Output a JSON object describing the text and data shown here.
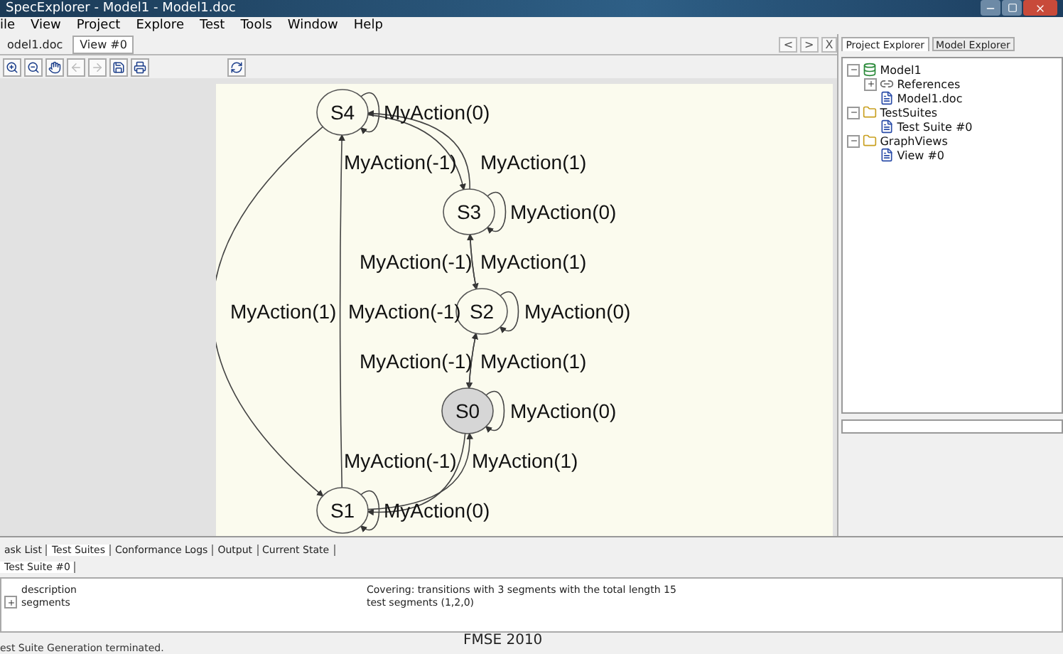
{
  "window": {
    "title": "SpecExplorer - Model1 - Model1.doc"
  },
  "menu": [
    "ile",
    "View",
    "Project",
    "Explore",
    "Test",
    "Tools",
    "Window",
    "Help"
  ],
  "document_tabs": [
    {
      "label": "odel1.doc",
      "selected": false
    },
    {
      "label": "View #0",
      "selected": true
    }
  ],
  "tab_controls": [
    "<",
    ">",
    "X"
  ],
  "toolbar": [
    {
      "kind": "zoom-in",
      "disabled": false
    },
    {
      "kind": "zoom-out",
      "disabled": false
    },
    {
      "kind": "hand",
      "disabled": false
    },
    {
      "kind": "back",
      "disabled": true
    },
    {
      "kind": "forward",
      "disabled": true
    },
    {
      "kind": "save",
      "disabled": false
    },
    {
      "kind": "print",
      "disabled": false
    },
    {
      "kind": "refresh",
      "disabled": false
    }
  ],
  "graph": {
    "nodes": [
      {
        "label": "S4",
        "initial": false
      },
      {
        "label": "S3",
        "initial": false
      },
      {
        "label": "S2",
        "initial": false
      },
      {
        "label": "S0",
        "initial": true
      },
      {
        "label": "S1",
        "initial": false
      }
    ],
    "edges": [
      {
        "label": "MyAction(0)"
      },
      {
        "label": "MyAction(-1)"
      },
      {
        "label": "MyAction(1)"
      },
      {
        "label": "MyAction(0)"
      },
      {
        "label": "MyAction(-1)"
      },
      {
        "label": "MyAction(1)"
      },
      {
        "label": "MyAction(1)"
      },
      {
        "label": "MyAction(-1)"
      },
      {
        "label": "MyAction(0)"
      },
      {
        "label": "MyAction(-1)"
      },
      {
        "label": "MyAction(1)"
      },
      {
        "label": "MyAction(0)"
      },
      {
        "label": "MyAction(-1)"
      },
      {
        "label": "MyAction(1)"
      },
      {
        "label": "MyAction(0)"
      }
    ]
  },
  "explorer": {
    "tabs": [
      {
        "label": "Project Explorer",
        "selected": true
      },
      {
        "label": "Model Explorer",
        "selected": false
      }
    ],
    "tree": [
      {
        "label": "Model1",
        "kind": "model",
        "expanded": true,
        "children": [
          {
            "label": "References",
            "kind": "references",
            "expanded": false
          },
          {
            "label": "Model1.doc",
            "kind": "doc"
          }
        ]
      },
      {
        "label": "TestSuites",
        "kind": "folder",
        "expanded": true,
        "children": [
          {
            "label": "Test Suite #0",
            "kind": "suite"
          }
        ]
      },
      {
        "label": "GraphViews",
        "kind": "folder",
        "expanded": true,
        "children": [
          {
            "label": "View #0",
            "kind": "view"
          }
        ]
      }
    ]
  },
  "bottom_panel": {
    "tabs": [
      {
        "label": "ask List",
        "selected": false
      },
      {
        "label": "Test Suites",
        "selected": true
      },
      {
        "label": "Conformance Logs",
        "selected": false
      },
      {
        "label": "Output",
        "selected": false
      },
      {
        "label": "Current State",
        "selected": false
      }
    ],
    "suite_tabs": [
      {
        "label": "Test Suite #0",
        "selected": true
      }
    ],
    "properties": [
      {
        "name": "description",
        "value": "Covering: transitions with 3 segments with the total length 15"
      },
      {
        "name": "segments",
        "value": "test segments (1,2,0)",
        "expanded": false
      }
    ]
  },
  "status": "est Suite Generation terminated.",
  "footer": "FMSE 2010"
}
